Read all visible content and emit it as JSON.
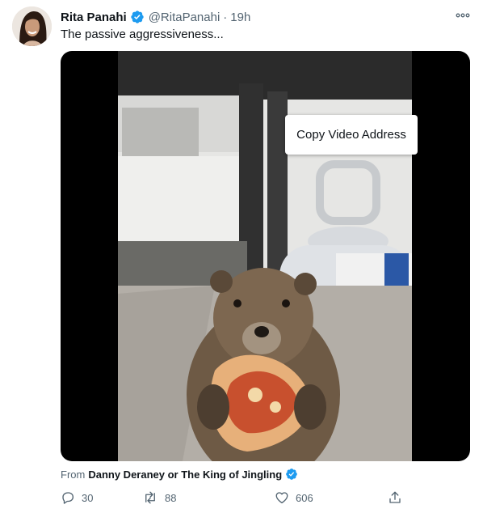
{
  "tweet": {
    "author": {
      "display_name": "Rita Panahi",
      "handle": "@RitaPanahi",
      "verified": true,
      "avatar_icon": "profile-photo"
    },
    "separator": "·",
    "time": "19h",
    "text": "The passive aggressiveness...",
    "more_icon": "ellipsis-icon"
  },
  "media": {
    "context_menu": {
      "item": "Copy Video Address"
    }
  },
  "attribution": {
    "prefix": "From",
    "source_name": "Danny Deraney or The King of Jingling",
    "verified": true
  },
  "actions": {
    "reply_count": "30",
    "retweet_count": "88",
    "like_count": "606",
    "icons": [
      "reply-icon",
      "retweet-icon",
      "like-icon",
      "share-icon"
    ]
  },
  "colors": {
    "verified_blue": "#1d9bf0",
    "secondary_text": "#536471",
    "primary_text": "#0f1419",
    "media_background": "#000000"
  }
}
